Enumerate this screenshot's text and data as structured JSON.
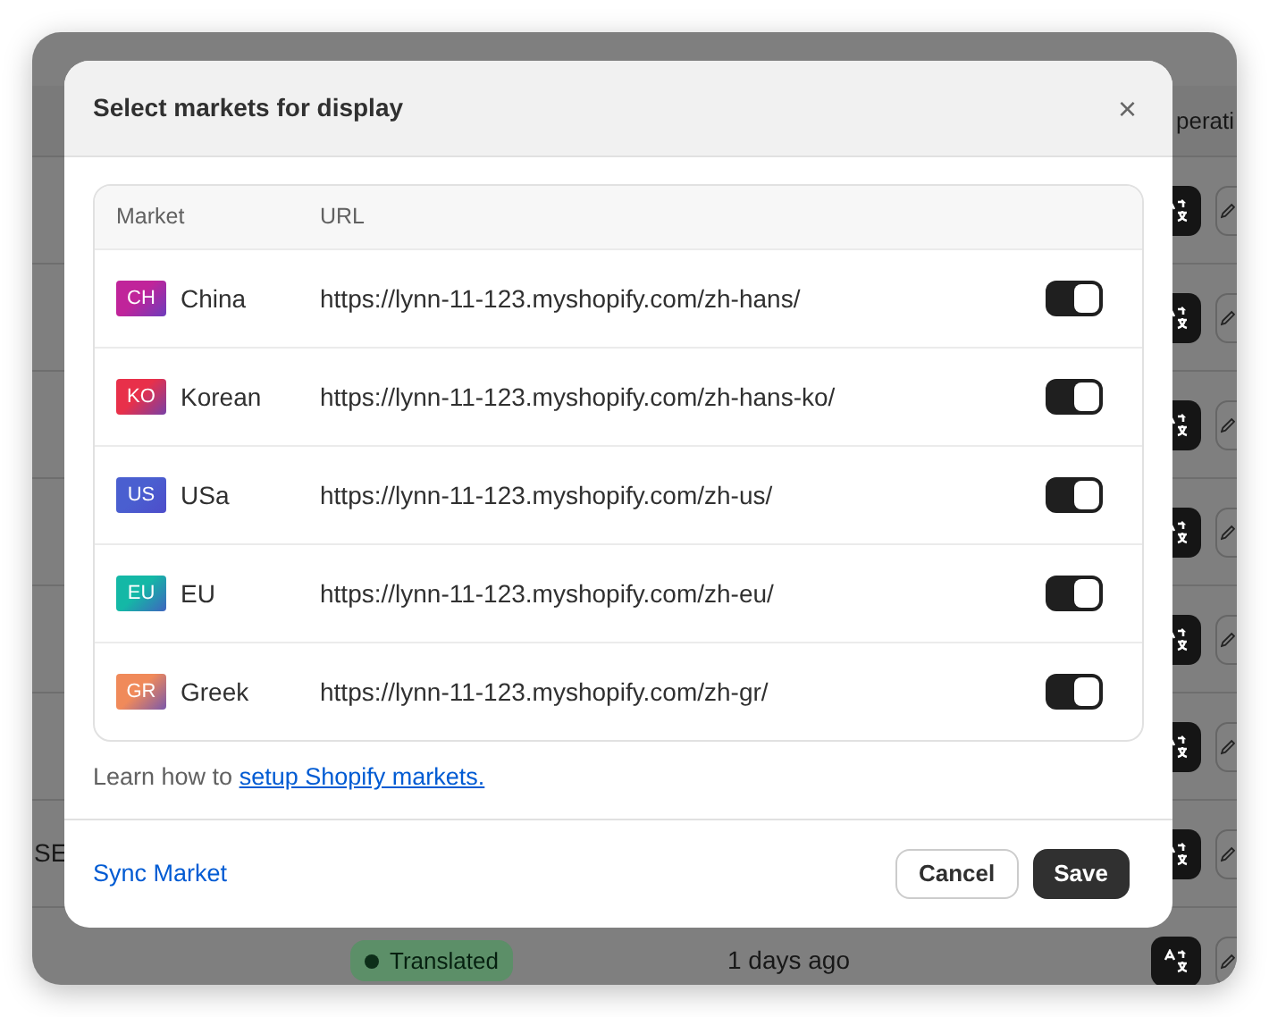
{
  "background": {
    "column_header": "perati",
    "rows": [
      {
        "label": null
      },
      {
        "label": null
      },
      {
        "label": null
      },
      {
        "label": null
      },
      {
        "label": null
      },
      {
        "label": null
      },
      {
        "label": "SE"
      },
      {
        "status": "Translated",
        "time": "1 days ago"
      }
    ]
  },
  "modal": {
    "title": "Select markets for display",
    "close": "×",
    "columns": [
      "Market",
      "URL"
    ],
    "markets": [
      {
        "code": "CH",
        "name": "China",
        "url": "https://lynn-11-123.myshopify.com/zh-hans/",
        "on": true,
        "color": "#c0249a"
      },
      {
        "code": "KO",
        "name": "Korean",
        "url": "https://lynn-11-123.myshopify.com/zh-hans-ko/",
        "on": true,
        "color": "#e8304a"
      },
      {
        "code": "US",
        "name": "USa",
        "url": "https://lynn-11-123.myshopify.com/zh-us/",
        "on": true,
        "color": "#4a5fd0"
      },
      {
        "code": "EU",
        "name": "EU",
        "url": "https://lynn-11-123.myshopify.com/zh-eu/",
        "on": true,
        "color": "#14b8a6"
      },
      {
        "code": "GR",
        "name": "Greek",
        "url": "https://lynn-11-123.myshopify.com/zh-gr/",
        "on": true,
        "color": "#f08a5a"
      }
    ],
    "help_text": "Learn how to",
    "help_link": "setup Shopify markets.",
    "sync_link": "Sync Market",
    "buttons": [
      "Cancel",
      "Save"
    ]
  }
}
